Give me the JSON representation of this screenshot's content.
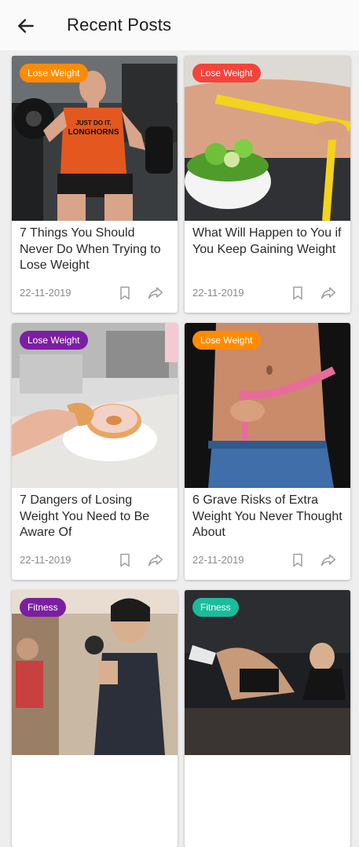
{
  "header": {
    "title": "Recent Posts",
    "back_icon": "arrow-left-icon"
  },
  "colors": {
    "orange": "#ff8c00",
    "red": "#f2443a",
    "purple": "#7b1fa2",
    "teal": "#1abc9c"
  },
  "posts": [
    {
      "category": "Lose Weight",
      "badge_color": "#ff8c00",
      "title": "7 Things You Should Never Do When Trying to Lose Weight",
      "date": "22-11-2019",
      "image_text": "JUST DO IT. LONGHORNS"
    },
    {
      "category": "Lose Weight",
      "badge_color": "#f2443a",
      "title": "What Will Happen to You if You Keep Gaining Weight",
      "date": "22-11-2019"
    },
    {
      "category": "Lose Weight",
      "badge_color": "#7b1fa2",
      "title": "7 Dangers of Losing Weight You Need to Be Aware Of",
      "date": "22-11-2019"
    },
    {
      "category": "Lose Weight",
      "badge_color": "#ff8c00",
      "title": "6 Grave Risks of Extra Weight You Never Thought About",
      "date": "22-11-2019"
    },
    {
      "category": "Fitness",
      "badge_color": "#7b1fa2",
      "title": "",
      "date": ""
    },
    {
      "category": "Fitness",
      "badge_color": "#1abc9c",
      "title": "",
      "date": ""
    }
  ]
}
